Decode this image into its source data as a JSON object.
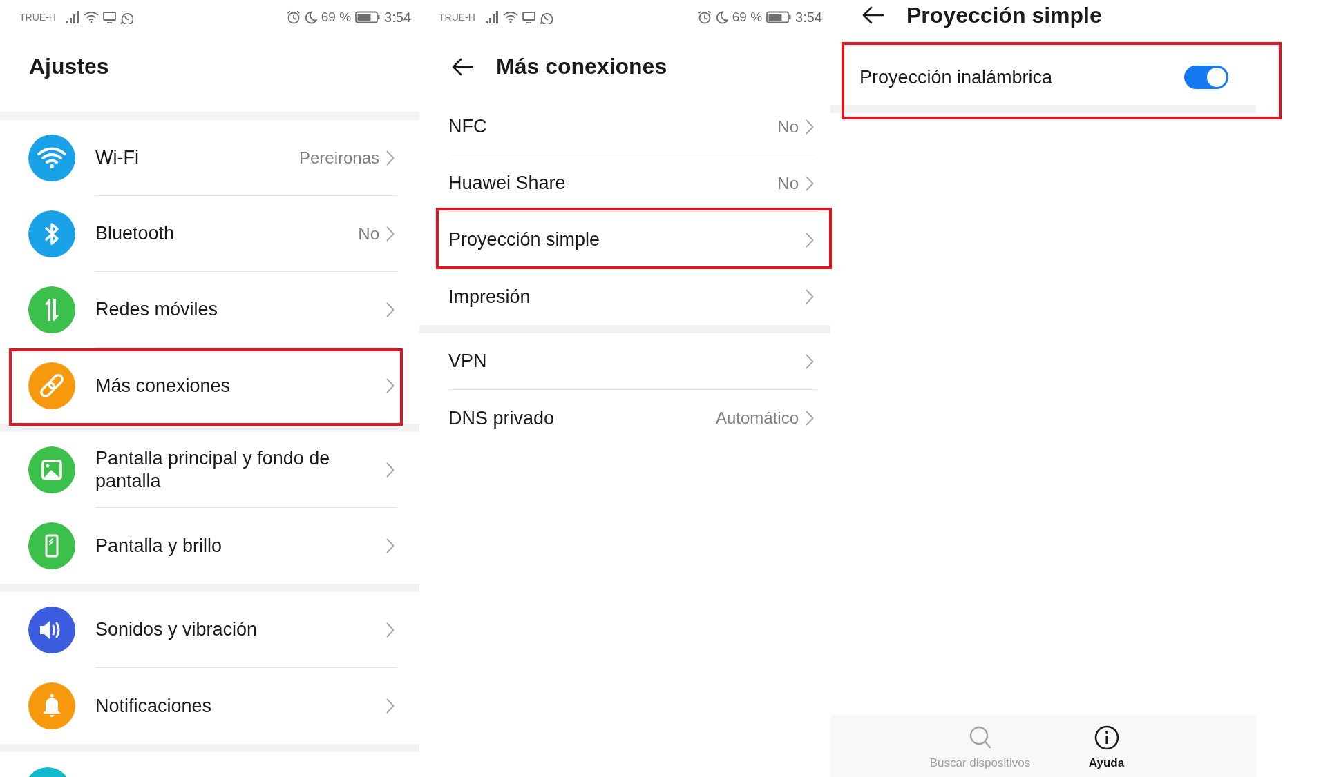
{
  "settings_screen": {
    "status_bar": {
      "carrier": "TRUE-H",
      "battery": "69 %",
      "time": "3:54"
    },
    "title": "Ajustes",
    "groups": [
      {
        "items": [
          {
            "label": "Wi-Fi",
            "value": "Pereironas",
            "color": "#1aa2e8",
            "highlighted": false
          },
          {
            "label": "Bluetooth",
            "value": "No",
            "color": "#1aa2e8",
            "highlighted": false
          },
          {
            "label": "Redes móviles",
            "color": "#3cc04c",
            "highlighted": false
          },
          {
            "label": "Más conexiones",
            "color": "#f7990d",
            "highlighted": true
          }
        ]
      },
      {
        "items": [
          {
            "label": "Pantalla principal y fondo de pantalla",
            "color": "#3cc04c",
            "highlighted": false
          },
          {
            "label": "Pantalla y brillo",
            "color": "#3cc04c",
            "highlighted": false
          }
        ]
      },
      {
        "items": [
          {
            "label": "Sonidos y vibración",
            "color": "#3d5de0",
            "highlighted": false
          },
          {
            "label": "Notificaciones",
            "color": "#f7990d",
            "highlighted": false
          }
        ]
      }
    ],
    "cut_off_item": {
      "color": "#12b8cc"
    }
  },
  "connections_screen": {
    "status_bar": {
      "carrier": "TRUE-H",
      "battery": "69 %",
      "time": "3:54"
    },
    "title": "Más conexiones",
    "groups": [
      {
        "items": [
          {
            "label": "NFC",
            "value": "No",
            "highlighted": false
          },
          {
            "label": "Huawei Share",
            "value": "No",
            "highlighted": false
          },
          {
            "label": "Proyección simple",
            "highlighted": true
          },
          {
            "label": "Impresión",
            "highlighted": false
          }
        ]
      },
      {
        "items": [
          {
            "label": "VPN",
            "highlighted": false
          },
          {
            "label": "DNS privado",
            "value": "Automático",
            "highlighted": false
          }
        ]
      }
    ]
  },
  "projection_screen": {
    "title": "Proyección simple",
    "items": [
      {
        "label": "Proyección inalámbrica",
        "on": true,
        "highlighted": true
      }
    ],
    "bottom_bar": [
      {
        "label": "Buscar dispositivos",
        "disabled": true
      },
      {
        "label": "Ayuda",
        "disabled": false
      }
    ]
  }
}
